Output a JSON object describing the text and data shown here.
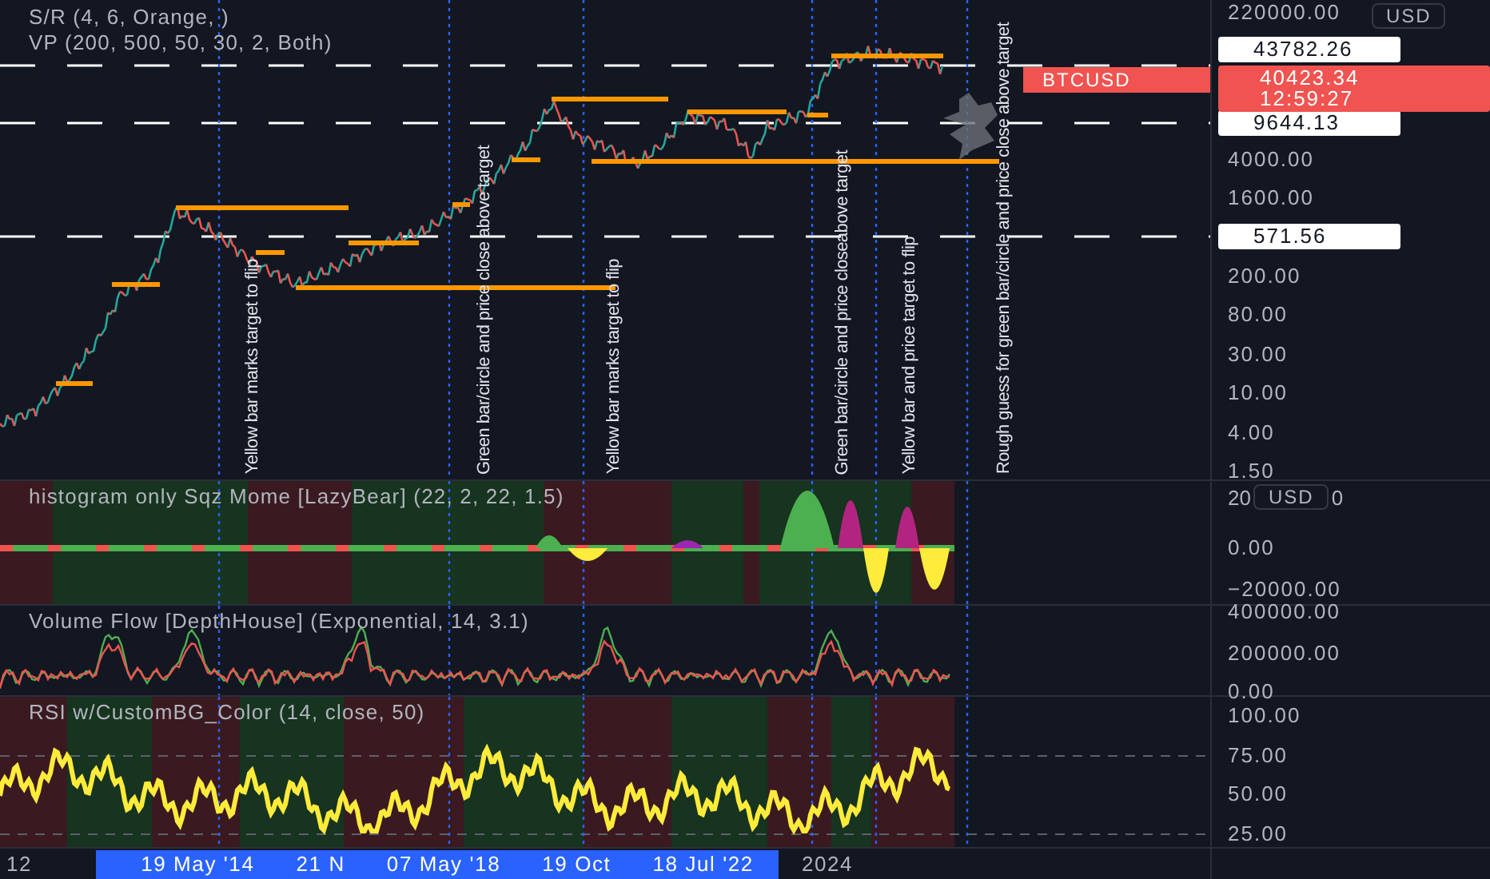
{
  "main_pane": {
    "legend": [
      "S/R (4, 6, Orange, )",
      "VP (200, 500, 50, 30, 2, Both)"
    ],
    "annotations": [
      "Yellow bar marks target to flip",
      "Green bar/circle and price close above target",
      "Yellow bar marks target to flip",
      "Green bar/circle and price closeabove target",
      "Yellow bar and price target to flip",
      "Rough guess for green bar/circle and price close above target"
    ],
    "price_axis": {
      "currency": "USD",
      "ticks": [
        "220000.00",
        "4000.00",
        "1600.00",
        "200.00",
        "80.00",
        "30.00",
        "10.00",
        "4.00",
        "1.50"
      ],
      "levels": [
        "43782.26",
        "9644.13",
        "571.56"
      ],
      "symbol_tag": "BTCUSD",
      "last_price": "40423.34",
      "countdown": "12:59:27"
    }
  },
  "squeeze_pane": {
    "title": "histogram only Sqz Mome [LazyBear] (22, 2, 22, 1.5)",
    "partial_tick": [
      "20",
      "0"
    ],
    "currency": "USD",
    "ticks": [
      "0.00",
      "−20000.00"
    ]
  },
  "volume_pane": {
    "title": "Volume Flow [DepthHouse] (Exponential, 14, 3.1)",
    "ticks": [
      "400000.00",
      "200000.00",
      "0.00"
    ]
  },
  "rsi_pane": {
    "title": "RSI w/CustomBG_Color (14, close, 50)",
    "ticks": [
      "100.00",
      "75.00",
      "50.00",
      "25.00"
    ]
  },
  "time_axis": {
    "start_label": "12",
    "range_labels": [
      "19 May '14",
      "21 N",
      "07 May '18",
      "19 Oct",
      "18 Jul '22"
    ],
    "end_label": "2024"
  }
}
